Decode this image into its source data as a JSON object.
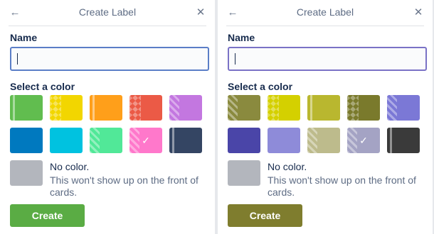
{
  "panels": [
    {
      "title": "Create Label",
      "back_icon": "←",
      "close_icon": "✕",
      "name_label": "Name",
      "name_value": "",
      "color_label": "Select a color",
      "colors": [
        {
          "color": "#61bd4f",
          "pattern": "bar",
          "selected": false
        },
        {
          "color": "#f2d600",
          "pattern": "diamond",
          "selected": false
        },
        {
          "color": "#ff9f1a",
          "pattern": "bar",
          "selected": false
        },
        {
          "color": "#eb5a46",
          "pattern": "diamond",
          "selected": false
        },
        {
          "color": "#c377e0",
          "pattern": "stripes",
          "selected": false
        },
        {
          "color": "#0079bf",
          "pattern": "none",
          "selected": false
        },
        {
          "color": "#00c2e0",
          "pattern": "none",
          "selected": false
        },
        {
          "color": "#51e898",
          "pattern": "stripes",
          "selected": false
        },
        {
          "color": "#ff78cb",
          "pattern": "stripes",
          "selected": true
        },
        {
          "color": "#344563",
          "pattern": "bar",
          "selected": false
        }
      ],
      "check_icon": "✓",
      "no_color_title": "No color.",
      "no_color_desc": "This won't show up on the front of cards.",
      "create_label": "Create",
      "create_color": "#5aac44"
    },
    {
      "title": "Create Label",
      "back_icon": "←",
      "close_icon": "✕",
      "name_label": "Name",
      "name_value": "",
      "color_label": "Select a color",
      "colors": [
        {
          "color": "#8a8a3e",
          "pattern": "stripes",
          "selected": false
        },
        {
          "color": "#d4d000",
          "pattern": "diamond",
          "selected": false
        },
        {
          "color": "#b9b72f",
          "pattern": "bar",
          "selected": false
        },
        {
          "color": "#7a7a2c",
          "pattern": "diamond",
          "selected": false
        },
        {
          "color": "#7b78d6",
          "pattern": "stripes",
          "selected": false
        },
        {
          "color": "#4a45a8",
          "pattern": "none",
          "selected": false
        },
        {
          "color": "#8e8bd9",
          "pattern": "none",
          "selected": false
        },
        {
          "color": "#bdbb8c",
          "pattern": "stripes",
          "selected": false
        },
        {
          "color": "#a4a3c4",
          "pattern": "stripes",
          "selected": true
        },
        {
          "color": "#3a3a3a",
          "pattern": "bar",
          "selected": false
        }
      ],
      "check_icon": "✓",
      "no_color_title": "No color.",
      "no_color_desc": "This won't show up on the front of cards.",
      "create_label": "Create",
      "create_color": "#7f7d2e"
    }
  ]
}
